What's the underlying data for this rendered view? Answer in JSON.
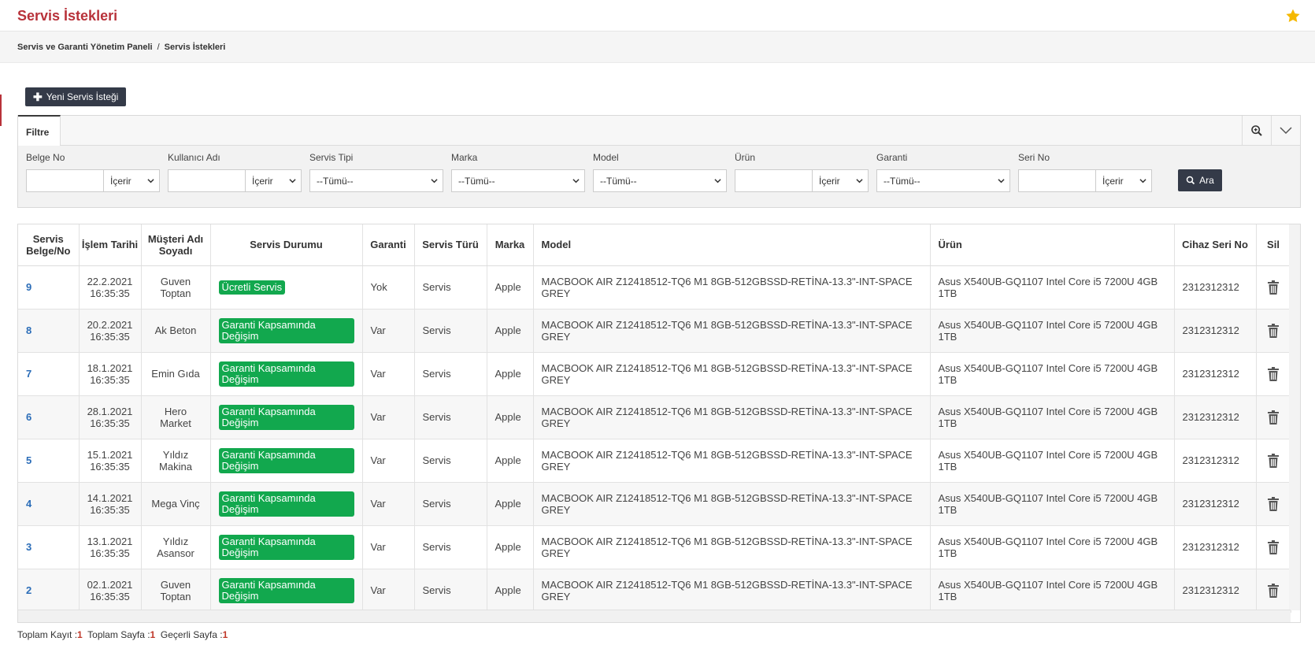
{
  "header": {
    "title": "Servis İstekleri"
  },
  "breadcrumb": {
    "items": [
      "Servis ve Garanti Yönetim Paneli",
      "Servis İstekleri"
    ],
    "separator": "/"
  },
  "toolbar": {
    "new_label": "Yeni Servis İsteği"
  },
  "filter": {
    "tab": "Filtre",
    "fields": [
      {
        "label": "Belge No",
        "op": "İçerir"
      },
      {
        "label": "Kullanıcı Adı",
        "op": "İçerir"
      },
      {
        "label": "Servis Tipi",
        "value": "--Tümü--"
      },
      {
        "label": "Marka",
        "value": "--Tümü--"
      },
      {
        "label": "Model",
        "value": "--Tümü--"
      },
      {
        "label": "Ürün",
        "op": "İçerir"
      },
      {
        "label": "Garanti",
        "value": "--Tümü--"
      },
      {
        "label": "Seri No",
        "op": "İçerir"
      }
    ],
    "search_label": "Ara"
  },
  "table": {
    "headers": [
      "Servis Belge/No",
      "İşlem Tarihi",
      "Müşteri Adı Soyadı",
      "Servis Durumu",
      "Garanti",
      "Servis Türü",
      "Marka",
      "Model",
      "Ürün",
      "Cihaz Seri No",
      "Sil"
    ],
    "rows": [
      {
        "no": "9",
        "date": "22.2.2021",
        "time": "16:35:35",
        "customer": "Guven Toptan",
        "status": "Ücretli Servis",
        "warranty": "Yok",
        "type": "Servis",
        "brand": "Apple",
        "model": "MACBOOK AIR Z12418512-TQ6 M1 8GB-512GBSSD-RETİNA-13.3\"-INT-SPACE GREY",
        "product": "Asus X540UB-GQ1107 Intel Core i5 7200U 4GB 1TB",
        "serial": "2312312312"
      },
      {
        "no": "8",
        "date": "20.2.2021",
        "time": "16:35:35",
        "customer": "Ak Beton",
        "status": "Garanti Kapsamında Değişim",
        "warranty": "Var",
        "type": "Servis",
        "brand": "Apple",
        "model": "MACBOOK AIR Z12418512-TQ6 M1 8GB-512GBSSD-RETİNA-13.3\"-INT-SPACE GREY",
        "product": "Asus X540UB-GQ1107 Intel Core i5 7200U 4GB 1TB",
        "serial": "2312312312"
      },
      {
        "no": "7",
        "date": "18.1.2021",
        "time": "16:35:35",
        "customer": "Emin Gıda",
        "status": "Garanti Kapsamında Değişim",
        "warranty": "Var",
        "type": "Servis",
        "brand": "Apple",
        "model": "MACBOOK AIR Z12418512-TQ6 M1 8GB-512GBSSD-RETİNA-13.3\"-INT-SPACE GREY",
        "product": "Asus X540UB-GQ1107 Intel Core i5 7200U 4GB 1TB",
        "serial": "2312312312"
      },
      {
        "no": "6",
        "date": "28.1.2021",
        "time": "16:35:35",
        "customer": "Hero Market",
        "status": "Garanti Kapsamında Değişim",
        "warranty": "Var",
        "type": "Servis",
        "brand": "Apple",
        "model": "MACBOOK AIR Z12418512-TQ6 M1 8GB-512GBSSD-RETİNA-13.3\"-INT-SPACE GREY",
        "product": "Asus X540UB-GQ1107 Intel Core i5 7200U 4GB 1TB",
        "serial": "2312312312"
      },
      {
        "no": "5",
        "date": "15.1.2021",
        "time": "16:35:35",
        "customer": "Yıldız Makina",
        "status": "Garanti Kapsamında Değişim",
        "warranty": "Var",
        "type": "Servis",
        "brand": "Apple",
        "model": "MACBOOK AIR Z12418512-TQ6 M1 8GB-512GBSSD-RETİNA-13.3\"-INT-SPACE GREY",
        "product": "Asus X540UB-GQ1107 Intel Core i5 7200U 4GB 1TB",
        "serial": "2312312312"
      },
      {
        "no": "4",
        "date": "14.1.2021",
        "time": "16:35:35",
        "customer": "Mega Vinç",
        "status": "Garanti Kapsamında Değişim",
        "warranty": "Var",
        "type": "Servis",
        "brand": "Apple",
        "model": "MACBOOK AIR Z12418512-TQ6 M1 8GB-512GBSSD-RETİNA-13.3\"-INT-SPACE GREY",
        "product": "Asus X540UB-GQ1107 Intel Core i5 7200U 4GB 1TB",
        "serial": "2312312312"
      },
      {
        "no": "3",
        "date": "13.1.2021",
        "time": "16:35:35",
        "customer": "Yıldız Asansor",
        "status": "Garanti Kapsamında Değişim",
        "warranty": "Var",
        "type": "Servis",
        "brand": "Apple",
        "model": "MACBOOK AIR Z12418512-TQ6 M1 8GB-512GBSSD-RETİNA-13.3\"-INT-SPACE GREY",
        "product": "Asus X540UB-GQ1107 Intel Core i5 7200U 4GB 1TB",
        "serial": "2312312312"
      },
      {
        "no": "2",
        "date": "02.1.2021",
        "time": "16:35:35",
        "customer": "Guven Toptan",
        "status": "Garanti Kapsamında Değişim",
        "warranty": "Var",
        "type": "Servis",
        "brand": "Apple",
        "model": "MACBOOK AIR Z12418512-TQ6 M1 8GB-512GBSSD-RETİNA-13.3\"-INT-SPACE GREY",
        "product": "Asus X540UB-GQ1107 Intel Core i5 7200U 4GB 1TB",
        "serial": "2312312312"
      }
    ]
  },
  "footer": {
    "total_records_label": "Toplam Kayıt :",
    "total_records": "1",
    "total_pages_label": "Toplam Sayfa :",
    "total_pages": "1",
    "current_page_label": "Geçerli Sayfa :",
    "current_page": "1"
  },
  "colors": {
    "accent": "#b8323a",
    "dark_button": "#343a48",
    "status_green": "#12a84e",
    "link": "#2b6db8",
    "star": "#f5b800"
  }
}
